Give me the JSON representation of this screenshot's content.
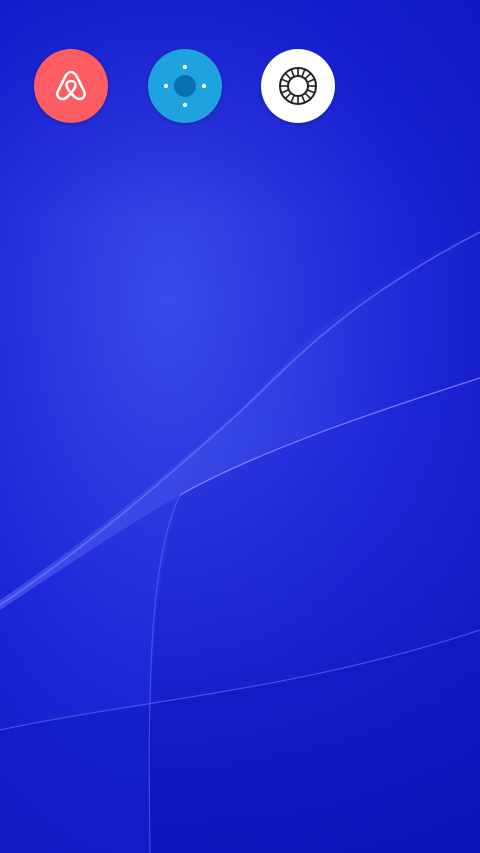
{
  "colors": {
    "wallpaper_base": "#1a1fd6",
    "wallpaper_light": "#4a5bf0",
    "wallpaper_dark": "#0c10b8",
    "airbnb_bg": "#fd5c63",
    "remote_bg": "#1fa2e0",
    "remote_accent": "#0a6fb0",
    "vsco_bg": "#ffffff",
    "vsco_fg": "#222222"
  },
  "apps": [
    {
      "icon": "airbnb-logo-icon",
      "bg": "#fd5c63"
    },
    {
      "icon": "remote-control-icon",
      "bg": "#1fa2e0"
    },
    {
      "icon": "vsco-lens-icon",
      "bg": "#ffffff"
    }
  ]
}
